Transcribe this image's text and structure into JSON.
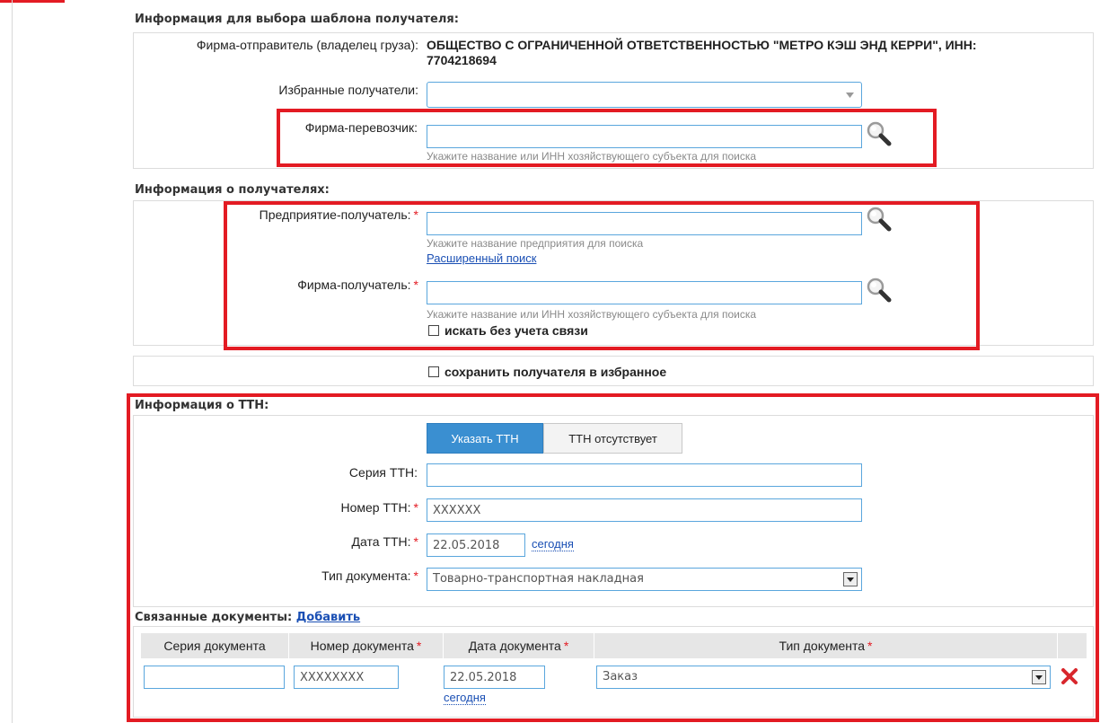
{
  "template_section": {
    "title": "Информация для выбора шаблона получателя:",
    "sender_label": "Фирма-отправитель (владелец груза):",
    "sender_value": "ОБЩЕСТВО С ОГРАНИЧЕННОЙ ОТВЕТСТВЕННОСТЬЮ \"МЕТРО КЭШ ЭНД КЕРРИ\", ИНН:",
    "sender_inn": "7704218694",
    "favorites_label": "Избранные получатели:",
    "favorites_value": "",
    "carrier_label": "Фирма-перевозчик:",
    "carrier_value": "",
    "carrier_hint": "Укажите название или ИНН хозяйствующего субъекта для поиска"
  },
  "recipients_section": {
    "title": "Информация о получателях:",
    "enterprise_label": "Предприятие-получатель:",
    "enterprise_value": "",
    "enterprise_hint": "Укажите название предприятия для поиска",
    "advanced_search": "Расширенный поиск",
    "firm_label": "Фирма-получатель:",
    "firm_value": "",
    "firm_hint": "Укажите название или ИНН хозяйствующего субъекта для поиска",
    "no_link_checkbox": "искать без учета связи"
  },
  "save_favorite_checkbox": "сохранить получателя в избранное",
  "ttn_section": {
    "title": "Информация о ТТН:",
    "tab_specify": "Указать ТТН",
    "tab_absent": "ТТН отсутствует",
    "series_label": "Серия ТТН:",
    "series_value": "",
    "number_label": "Номер ТТН:",
    "number_value": "XXXXXX",
    "date_label": "Дата ТТН:",
    "date_value": "22.05.2018",
    "today_link": "сегодня",
    "doc_type_label": "Тип документа:",
    "doc_type_value": "Товарно-транспортная накладная"
  },
  "related_docs": {
    "title": "Связанные документы:",
    "add_link": "Добавить",
    "headers": {
      "series": "Серия документа",
      "number": "Номер документа",
      "date": "Дата документа",
      "type": "Тип документа"
    },
    "row": {
      "series": "",
      "number": "XXXXXXXX",
      "date": "22.05.2018",
      "today": "сегодня",
      "type": "Заказ"
    }
  },
  "required_mark": "*",
  "colors": {
    "highlight_red": "#e31b23",
    "accent_blue": "#3a8fd1",
    "input_border": "#5aa6dd",
    "link": "#1a4fb4"
  }
}
